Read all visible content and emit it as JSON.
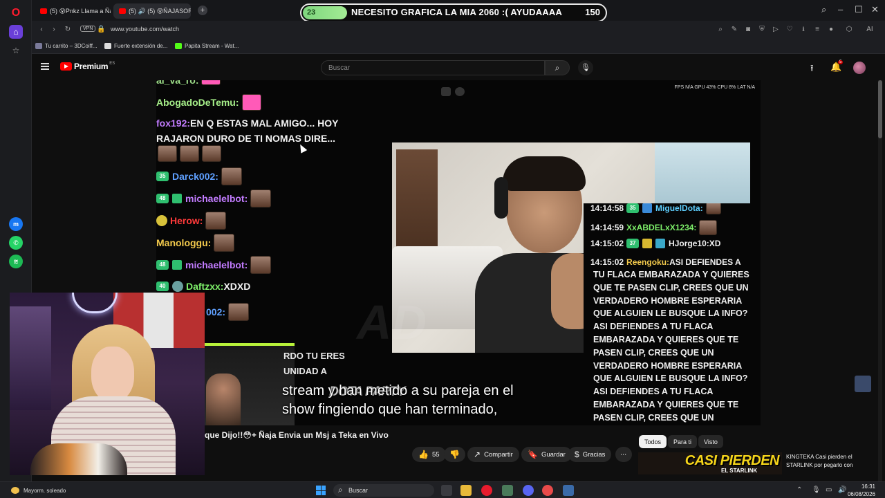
{
  "browser": {
    "tabs": [
      {
        "label": "(5) 😵Pnkz Llama a Ñajas"
      },
      {
        "label": "(5) 🔊 (5) 😵ÑAJASOR le Re"
      }
    ],
    "address": {
      "vpn": "VPN",
      "url": "www.youtube.com/watch"
    },
    "bookmarks": [
      {
        "label": "Tu carrito – 3DCoiff..."
      },
      {
        "label": "Fuerte extensión de..."
      },
      {
        "label": "Papita Stream - Wat..."
      }
    ],
    "sidebar_icons": [
      "opera-logo-icon",
      "home-icon",
      "bookmark-icon",
      "messenger-icon",
      "whatsapp-icon",
      "spotify-icon"
    ]
  },
  "banner": {
    "count": "23",
    "text": "NECESITO GRAFICA LA MIA 2060 :( AYUDAAAA",
    "goal": "150"
  },
  "youtube": {
    "logo": "Premium",
    "country": "ES",
    "search_placeholder": "Buscar",
    "notifications": "5",
    "video_title": "que Dijo!!😳+ Ñaja Envia un Msj a Teka en Vivo",
    "actions": {
      "likes": "55",
      "share": "Compartir",
      "save": "Guardar",
      "thanks": "Gracias"
    },
    "chips": [
      "Todos",
      "Para ti",
      "Visto"
    ],
    "recommendation": {
      "thumb_text": "CASI PIERDEN",
      "thumb_sub": "EL STARLINK",
      "title": "KINGTEKA Casi pierden el STARLINK por pegarlo con"
    }
  },
  "stream": {
    "hud": "FPS N/A   GPU 43%   CPU 8%   LAT N/A",
    "overlay_chat": [
      {
        "user": "al_va_ro:",
        "color": "#9fe08a",
        "msg": ""
      },
      {
        "user": "AbogadoDeTemu:",
        "color": "#a7f08a",
        "msg": ""
      },
      {
        "user": "fox192:",
        "color": "#c27cff",
        "msg": " EN Q ESTAS MAL AMIGO... HOY"
      },
      {
        "user": "",
        "color": "#f2f2f2",
        "msg": "RAJARON DURO DE TI NOMAS DIRE..."
      },
      {
        "user": "Darck002:",
        "color": "#5fa0ff",
        "msg": "",
        "badge": "35"
      },
      {
        "user": "michaelelbot:",
        "color": "#c27cff",
        "msg": "",
        "badge": "48"
      },
      {
        "user": "Herow:",
        "color": "#ff3a3a",
        "msg": ""
      },
      {
        "user": "Manologgu:",
        "color": "#f2c94c",
        "msg": ""
      },
      {
        "user": "michaelelbot:",
        "color": "#c27cff",
        "msg": "",
        "badge": "48"
      },
      {
        "user": "Daftzxx:",
        "color": "#7ef06a",
        "msg": " XDXD",
        "badge": "40"
      },
      {
        "user": "002:",
        "color": "#5fa0ff",
        "msg": ""
      }
    ],
    "inner_chat": [
      {
        "time": "14:14:58",
        "user": "MiguelDota:",
        "color": "#5fd0ff",
        "badge": "35",
        "msg": ""
      },
      {
        "time": "14:14:59",
        "user": "XxABDELxX1234:",
        "color": "#7ef06a",
        "badge": "",
        "msg": ""
      },
      {
        "time": "14:15:02",
        "user": "HJorge10:",
        "color": "#f0f0f0",
        "badge": "37",
        "msg": " XD"
      },
      {
        "time": "14:15:02",
        "user": "Reengoku:",
        "color": "#f2c94c",
        "badge": "",
        "msg": " ASI DEFIENDES A"
      }
    ],
    "inner_chat_body": "TU FLACA EMBARAZADA Y QUIERES QUE TE PASEN CLIP, CREES QUE UN VERDADERO HOMBRE ESPERARIA QUE ALGUIEN LE BUSQUE LA INFO? ASI DEFIENDES A TU FLACA EMBARAZADA Y QUIERES QUE TE PASEN CLIP, CREES QUE UN VERDADERO HOMBRE ESPERARIA QUE ALGUIEN LE BUSQUE LA INFO? ASI DEFIENDES A TU FLACA EMBARAZADA Y QUIERES QUE TE PASEN CLIP, CREES QUE UN",
    "left_partial_lines": [
      "RDO TU ERES",
      "UNIDAD A"
    ],
    "watermark": "AD",
    "tag": "DOTA PARTY",
    "subtitles": [
      "stream y han metido a su pareja en el",
      "show fingiendo que han terminado,"
    ]
  },
  "taskbar": {
    "weather": "Mayorm. soleado",
    "search": "Buscar",
    "time": "16:31",
    "date": "06/08/2026"
  },
  "colors": {
    "youtube_red": "#ff0000",
    "banner_green": "#8ee088",
    "dark_bg": "#0f0f0f"
  }
}
